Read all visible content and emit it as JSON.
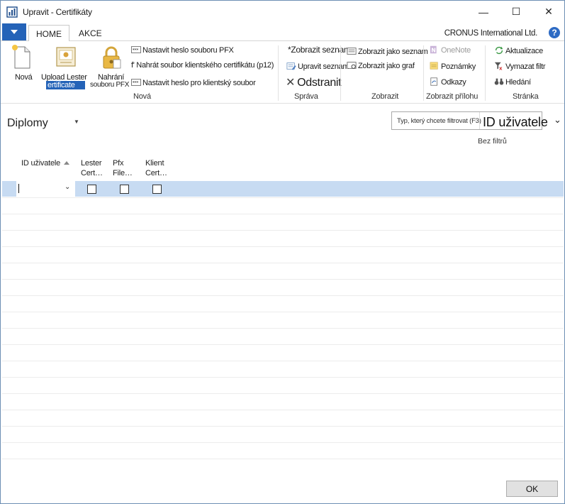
{
  "window": {
    "title": "Upravit - Certifikáty",
    "minimize_glyph": "—",
    "maximize_glyph": "☐",
    "close_glyph": "✕"
  },
  "tabs": [
    {
      "label": "HOME",
      "active": true
    },
    {
      "label": "AKCE",
      "active": false
    }
  ],
  "company": "CRONUS International Ltd.",
  "help_glyph": "?",
  "ribbon": {
    "nova": {
      "group_label": "Nová",
      "new_label": "Nová",
      "upload_label_1": "Upload Lester",
      "upload_label_2": "ertificate",
      "upload_pfx_label_1": "Nahrání",
      "upload_pfx_label_2": "souboru PFX",
      "set_pfx_password": "Nastavit heslo souboru PFX",
      "upload_client_cert": "f' Nahrát soubor klientského certifikátu (p12)",
      "set_client_password": "Nastavit heslo pro klientský soubor"
    },
    "sprava": {
      "group_label": "Správa",
      "show_list": "*Zobrazit seznam",
      "edit_list": "Upravit seznam",
      "delete": "Odstranit"
    },
    "zobrazit": {
      "group_label": "Zobrazit",
      "as_list": "Zobrazit jako seznam",
      "as_chart": "Zobrazit jako graf"
    },
    "priloha": {
      "group_label": "Zobrazit přílohu",
      "onenote": "OneNote",
      "notes": "Poznámky",
      "links": "Odkazy"
    },
    "stranka": {
      "group_label": "Stránka",
      "refresh": "Aktualizace",
      "clear_filter": "Vymazat filtr",
      "find": "Hledání"
    }
  },
  "page": {
    "title": "Diplomy",
    "filter_placeholder": "Typ, který chcete filtrovat (F3)",
    "filter_field": "ID uživatele",
    "filter_status": "Bez filtrů"
  },
  "grid": {
    "columns": [
      {
        "line1": "ID uživatele",
        "line2": ""
      },
      {
        "line1": "Lester",
        "line2": "Cert…"
      },
      {
        "line1": "Pfx",
        "line2": "File…"
      },
      {
        "line1": "Klient",
        "line2": "Cert…"
      }
    ],
    "rows": [
      {
        "id": "",
        "lester": false,
        "pfx": false,
        "client": false
      }
    ]
  },
  "footer": {
    "ok_label": "OK"
  },
  "colors": {
    "accent": "#2463b8",
    "selection": "#c7dbf2"
  }
}
